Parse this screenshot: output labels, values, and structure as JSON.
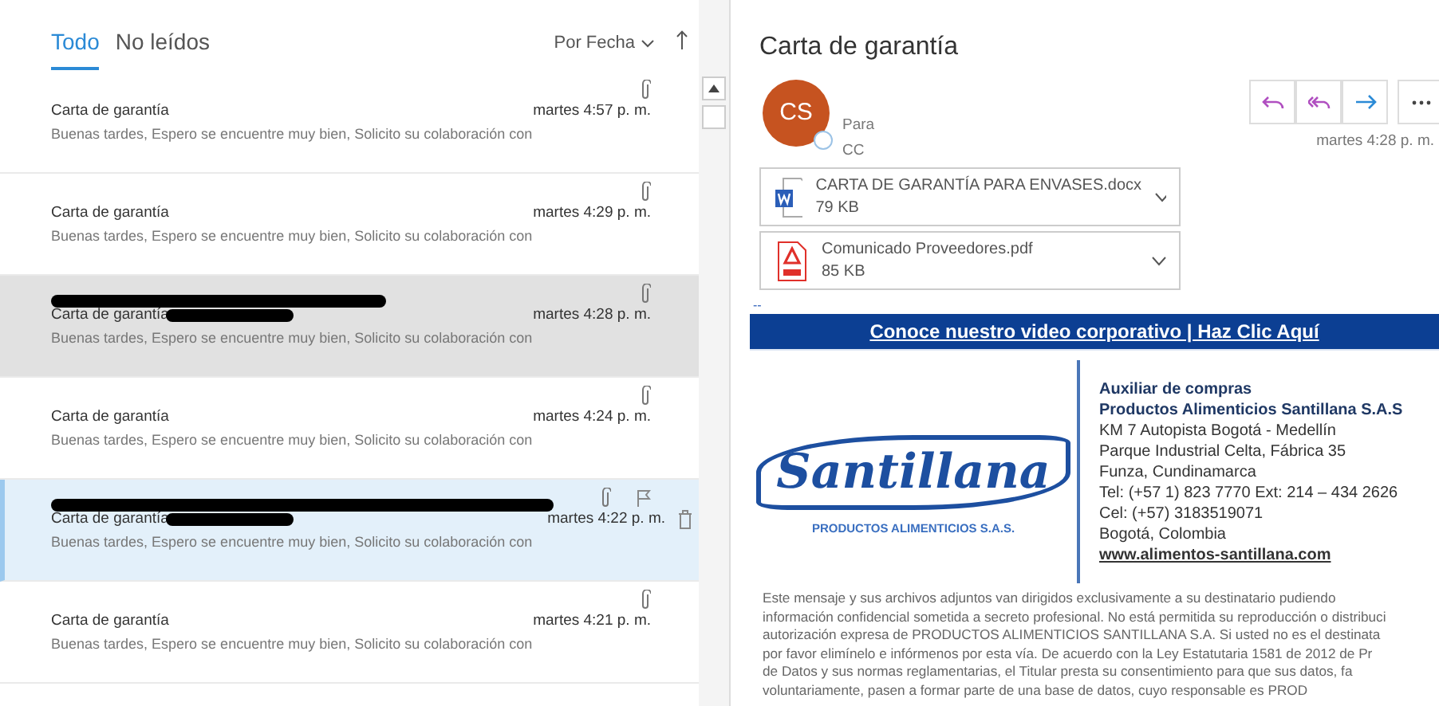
{
  "list": {
    "tabs": [
      {
        "label": "Todo",
        "selected": true
      },
      {
        "label": "No leídos",
        "selected": false
      }
    ],
    "sort": "Por Fecha",
    "messages": [
      {
        "subject": "Carta de garantía",
        "preview": "Buenas tardes,  Espero se encuentre muy bien,   Solicito su colaboración con",
        "time": "martes 4:57 p. m.",
        "selected": false,
        "hovered": false,
        "redacted": false
      },
      {
        "subject": "Carta de garantía",
        "preview": "Buenas tardes,  Espero se encuentre muy bien,   Solicito su colaboración con",
        "time": "martes 4:29 p. m.",
        "selected": false,
        "hovered": false,
        "redacted": false
      },
      {
        "subject": "Carta de garantía",
        "preview": "Buenas tardes,  Espero se encuentre muy bien,   Solicito su colaboración con",
        "time": "martes 4:28 p. m.",
        "selected": true,
        "hovered": false,
        "redacted": true
      },
      {
        "subject": "Carta de garantía",
        "preview": "Buenas tardes,  Espero se encuentre muy bien,   Solicito su colaboración con",
        "time": "martes 4:24 p. m.",
        "selected": false,
        "hovered": false,
        "redacted": false
      },
      {
        "subject": "Carta de garantía",
        "preview": "Buenas tardes,  Espero se encuentre muy bien,   Solicito su colaboración con",
        "time": "martes 4:22 p. m.",
        "selected": false,
        "hovered": true,
        "redacted": true
      },
      {
        "subject": "Carta de garantía",
        "preview": "Buenas tardes,  Espero se encuentre muy bien,   Solicito su colaboración con",
        "time": "martes 4:21 p. m.",
        "selected": false,
        "hovered": false,
        "redacted": false
      }
    ]
  },
  "reading": {
    "title": "Carta de garantía",
    "avatar": "CS",
    "to_label": "Para",
    "cc_label": "CC",
    "time": "martes 4:28 p. m.",
    "attachments": [
      {
        "kind": "word",
        "name": "CARTA DE GARANTÍA PARA ENVASES.docx",
        "size": "79 KB"
      },
      {
        "kind": "pdf",
        "name": "Comunicado Proveedores.pdf",
        "size": "85 KB"
      }
    ],
    "separator": "--",
    "banner": "Conoce nuestro video corporativo | Haz Clic Aquí",
    "logo": {
      "name": "Santillana",
      "tagline": "PRODUCTOS ALIMENTICIOS S.A.S."
    },
    "signature": [
      {
        "kind": "bold",
        "text": "Auxiliar de compras"
      },
      {
        "kind": "bold",
        "text": "Productos Alimenticios Santillana S.A.S"
      },
      {
        "kind": "plain",
        "text": "KM 7 Autopista Bogotá - Medellín"
      },
      {
        "kind": "plain",
        "text": "Parque Industrial Celta, Fábrica 35"
      },
      {
        "kind": "plain",
        "text": "Funza, Cundinamarca"
      },
      {
        "kind": "plain",
        "text": "Tel: (+57 1) 823 7770 Ext: 214 – 434 2626"
      },
      {
        "kind": "plain",
        "text": "Cel: (+57) 3183519071"
      },
      {
        "kind": "plain",
        "text": "Bogotá, Colombia"
      },
      {
        "kind": "link",
        "text": "www.alimentos-santillana.com"
      }
    ],
    "disclaimer": [
      "Este mensaje y sus archivos adjuntos van dirigidos exclusivamente a su destinatario pudiendo",
      "información confidencial sometida a secreto profesional. No está permitida su reproducción o distribuci",
      "autorización expresa de PRODUCTOS ALIMENTICIOS SANTILLANA S.A. Si usted no es el destinata",
      "por favor elimínelo e infórmenos por esta vía. De acuerdo con la Ley Estatutaria 1581 de 2012 de Pr",
      "de Datos y sus normas reglamentarias, el Titular presta su consentimiento para que sus datos, fa",
      "voluntariamente, pasen a formar parte de una base de datos, cuyo responsable es PROD"
    ]
  }
}
